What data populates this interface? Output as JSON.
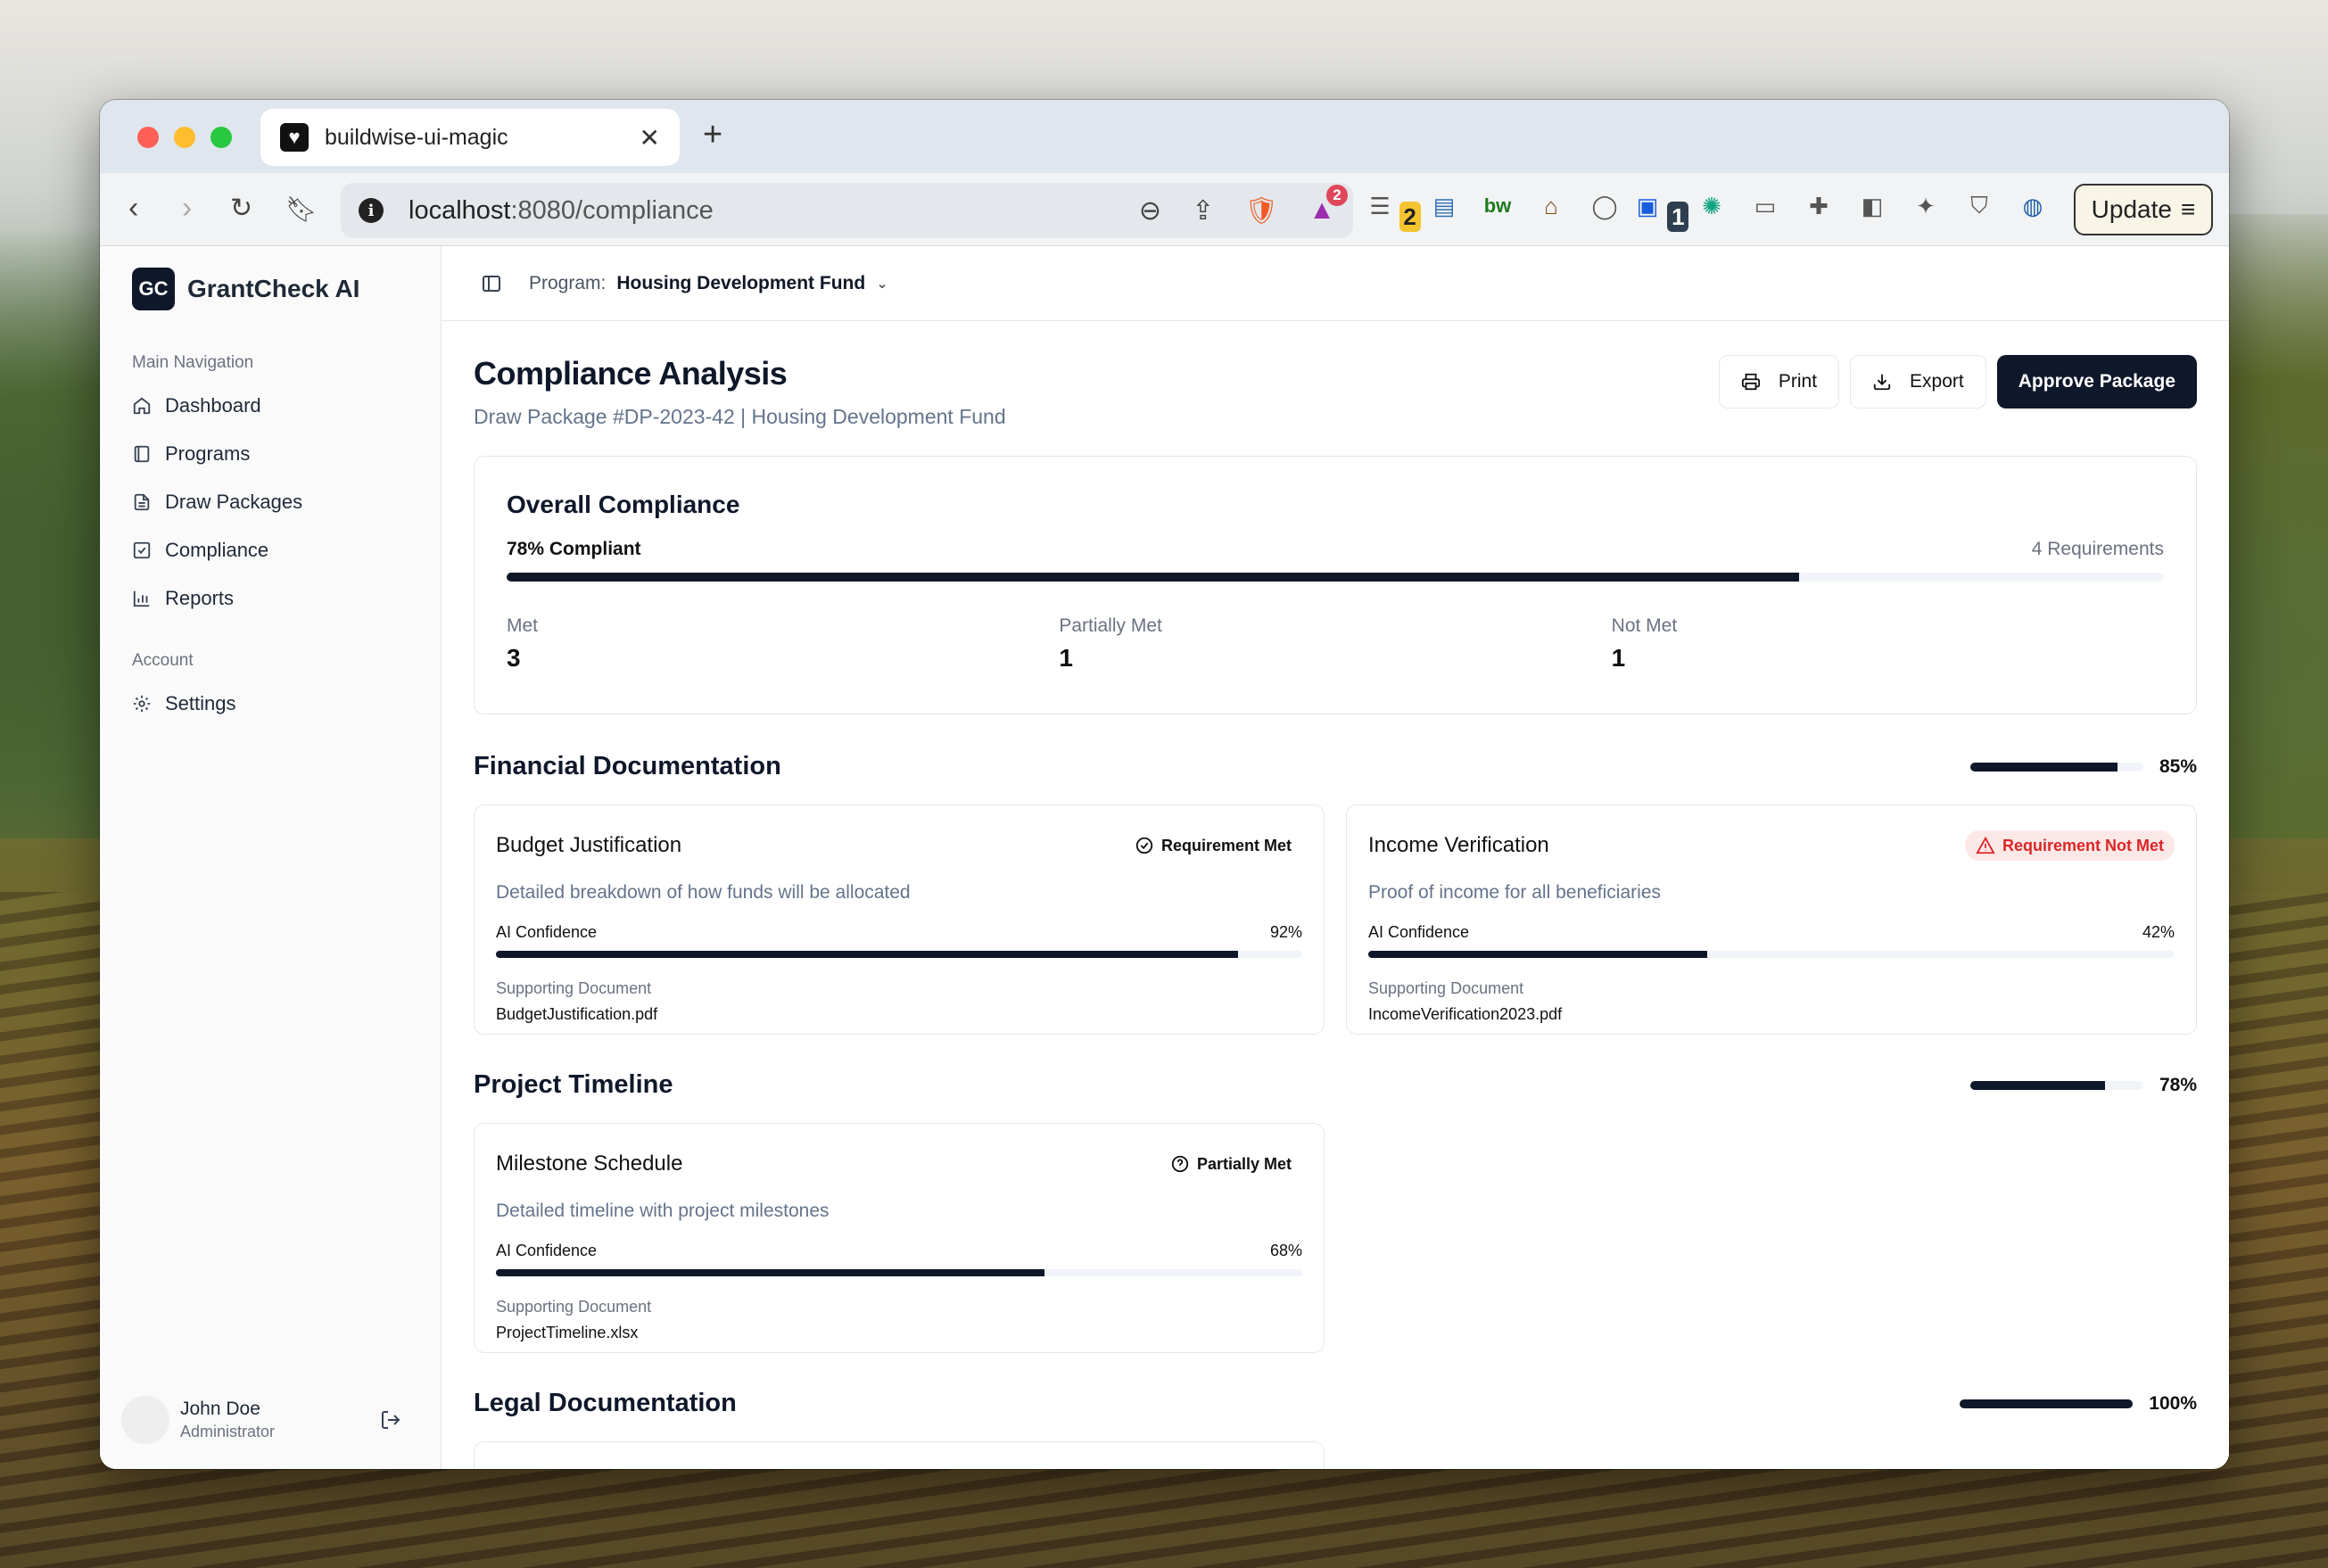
{
  "browser": {
    "tab_title": "buildwise-ui-magic",
    "url_host": "localhost",
    "url_path": ":8080/compliance",
    "ext_badge_a": "2",
    "ext_badge_b": "1",
    "brave_badge": "2",
    "update_label": "Update"
  },
  "sidebar": {
    "logo": "GC",
    "app_name": "GrantCheck AI",
    "main_label": "Main Navigation",
    "items": [
      {
        "label": "Dashboard",
        "icon": "home-icon"
      },
      {
        "label": "Programs",
        "icon": "book-icon"
      },
      {
        "label": "Draw Packages",
        "icon": "file-icon"
      },
      {
        "label": "Compliance",
        "icon": "check-square-icon"
      },
      {
        "label": "Reports",
        "icon": "bar-chart-icon"
      }
    ],
    "account_label": "Account",
    "settings_label": "Settings",
    "user_name": "John Doe",
    "user_role": "Administrator"
  },
  "topbar": {
    "program_label": "Program:",
    "program_value": "Housing Development Fund"
  },
  "page": {
    "title": "Compliance Analysis",
    "subtitle": "Draw Package #DP-2023-42 | Housing Development Fund",
    "print_label": "Print",
    "export_label": "Export",
    "approve_label": "Approve Package"
  },
  "overall": {
    "title": "Overall Compliance",
    "percent_label": "78% Compliant",
    "percent_value": 0.78,
    "requirements_label": "4 Requirements",
    "stats": [
      {
        "label": "Met",
        "value": "3"
      },
      {
        "label": "Partially Met",
        "value": "1"
      },
      {
        "label": "Not Met",
        "value": "1"
      }
    ]
  },
  "sections": [
    {
      "title": "Financial Documentation",
      "percent_label": "85%",
      "percent_value": 0.85,
      "cards": [
        {
          "title": "Budget Justification",
          "status": "Requirement Met",
          "status_kind": "met",
          "description": "Detailed breakdown of how funds will be allocated",
          "confidence_label": "AI Confidence",
          "confidence_text": "92%",
          "confidence_value": 0.92,
          "doc_label": "Supporting Document",
          "doc_name": "BudgetJustification.pdf"
        },
        {
          "title": "Income Verification",
          "status": "Requirement Not Met",
          "status_kind": "notmet",
          "description": "Proof of income for all beneficiaries",
          "confidence_label": "AI Confidence",
          "confidence_text": "42%",
          "confidence_value": 0.42,
          "doc_label": "Supporting Document",
          "doc_name": "IncomeVerification2023.pdf"
        }
      ]
    },
    {
      "title": "Project Timeline",
      "percent_label": "78%",
      "percent_value": 0.78,
      "cards": [
        {
          "title": "Milestone Schedule",
          "status": "Partially Met",
          "status_kind": "partial",
          "description": "Detailed timeline with project milestones",
          "confidence_label": "AI Confidence",
          "confidence_text": "68%",
          "confidence_value": 0.68,
          "doc_label": "Supporting Document",
          "doc_name": "ProjectTimeline.xlsx"
        }
      ]
    },
    {
      "title": "Legal Documentation",
      "percent_label": "100%",
      "percent_value": 1.0,
      "cards": []
    }
  ]
}
